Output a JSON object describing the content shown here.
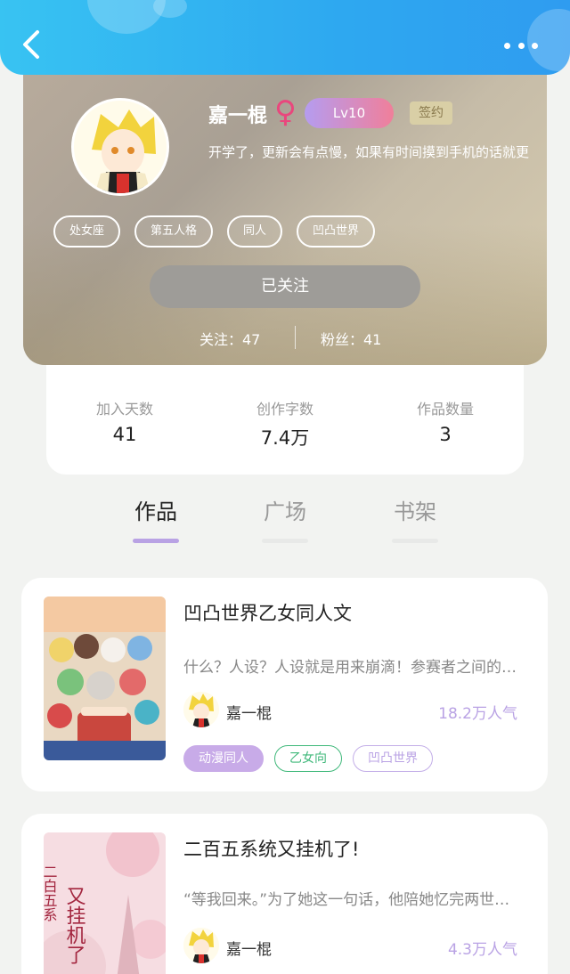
{
  "topbar": {
    "back_icon": "back-arrow-icon",
    "more_icon": "more-dots-icon"
  },
  "profile": {
    "username": "嘉一棍",
    "gender_icon": "♀",
    "level": "Lv10",
    "signed_badge": "签约",
    "bio": "开学了，更新会有点慢，如果有时间摸到手机的话就更",
    "tags": [
      "处女座",
      "第五人格",
      "同人",
      "凹凸世界"
    ],
    "follow_button": "已关注",
    "following": "关注：47",
    "followers": "粉丝：41"
  },
  "stats": [
    {
      "label": "加入天数",
      "value": "41"
    },
    {
      "label": "创作字数",
      "value": "7.4万"
    },
    {
      "label": "作品数量",
      "value": "3"
    }
  ],
  "tabs": [
    {
      "label": "作品",
      "active": true
    },
    {
      "label": "广场",
      "active": false
    },
    {
      "label": "书架",
      "active": false
    }
  ],
  "books": [
    {
      "title": "凹凸世界乙女同人文",
      "desc": "什么？人设？人设就是用来崩滴！参赛者之间的…",
      "author": "嘉一棍",
      "popularity": "18.2万人气",
      "tags": [
        "动漫同人",
        "乙女向",
        "凹凸世界"
      ]
    },
    {
      "title": "二百五系统又挂机了!",
      "desc": "“等我回来。”为了她这一句话，他陪她忆完两世…",
      "author": "嘉一棍",
      "popularity": "4.3万人气",
      "cover_text": "二百五系统又挂机了"
    }
  ],
  "colors": {
    "topbar": "#2ea8f0",
    "accent_purple": "#b9a2e4",
    "green": "#3fb87a",
    "gender_pink": "#e9477d"
  }
}
